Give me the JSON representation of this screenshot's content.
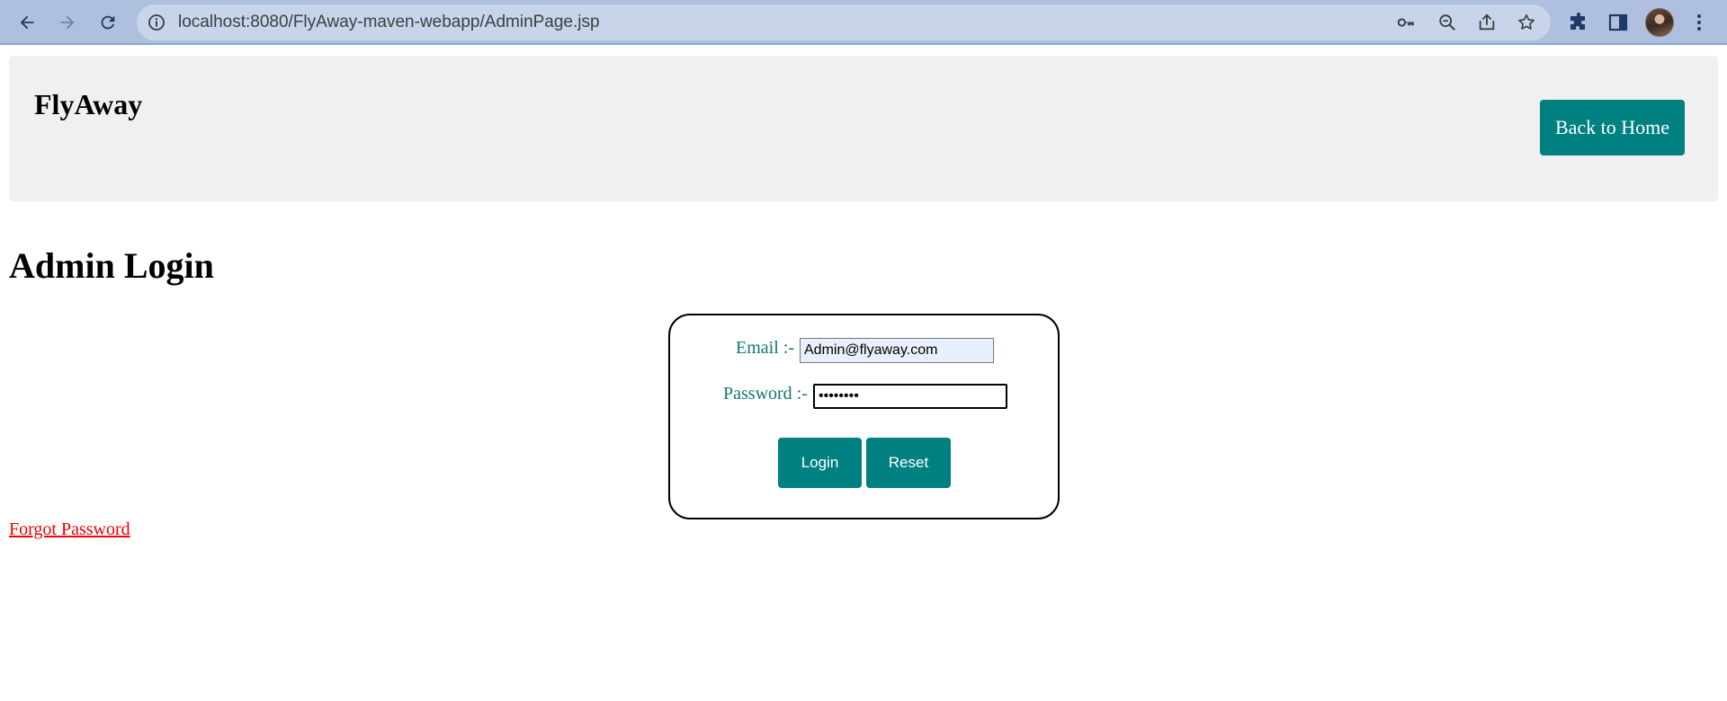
{
  "browser": {
    "url": "localhost:8080/FlyAway-maven-webapp/AdminPage.jsp"
  },
  "header": {
    "brand": "FlyAway",
    "home_button": "Back to Home"
  },
  "main": {
    "title": "Admin Login",
    "form": {
      "email_label": "Email :-",
      "email_value": "Admin@flyaway.com",
      "password_label": "Password :-",
      "password_value": "••••••••",
      "login_button": "Login",
      "reset_button": "Reset"
    },
    "forgot_link": "Forgot Password"
  },
  "colors": {
    "accent": "#008080",
    "label": "#147575",
    "link": "#ee0000",
    "chrome": "#aec0de"
  }
}
